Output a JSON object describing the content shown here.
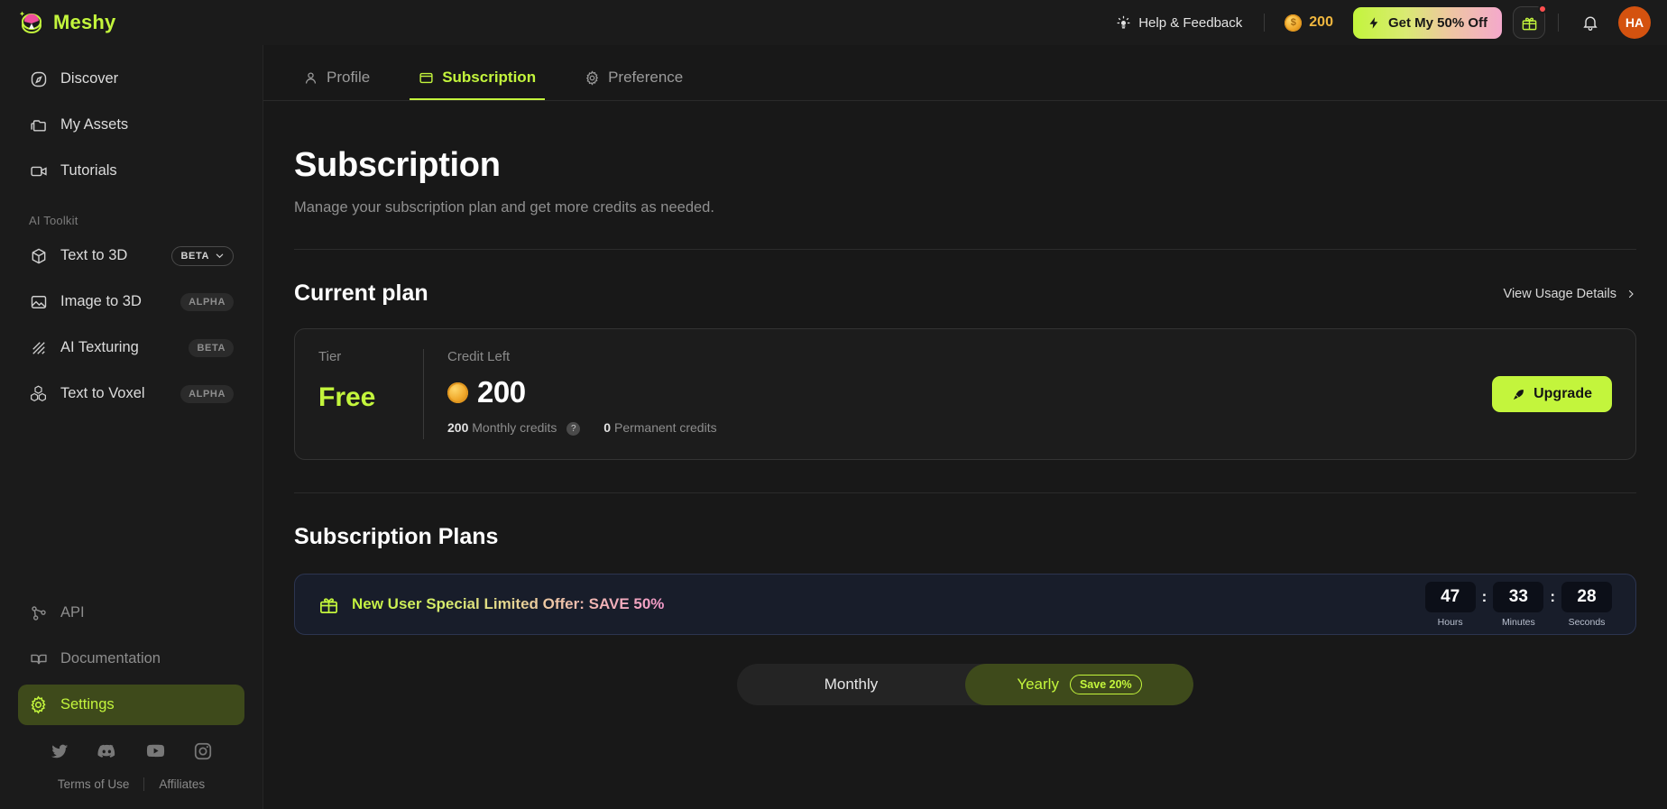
{
  "brand": {
    "name": "Meshy",
    "logo_icon": "meshy-logo-icon"
  },
  "topbar": {
    "help_label": "Help & Feedback",
    "help_icon": "lightbulb-icon",
    "credits_value": "200",
    "coin_icon": "coin-icon",
    "promo_label": "Get My 50% Off",
    "promo_icon": "bolt-icon",
    "gift_icon": "gift-icon",
    "bell_icon": "bell-icon",
    "avatar_initials": "HA"
  },
  "sidebar": {
    "items": [
      {
        "label": "Discover",
        "icon": "compass-icon"
      },
      {
        "label": "My Assets",
        "icon": "folder-icon"
      },
      {
        "label": "Tutorials",
        "icon": "video-icon"
      }
    ],
    "group_label": "AI Toolkit",
    "toolkit": [
      {
        "label": "Text to 3D",
        "icon": "cube-icon",
        "tag": "BETA",
        "tag_style": "outlined",
        "tag_chevron": "chevron-down-icon"
      },
      {
        "label": "Image to 3D",
        "icon": "image-icon",
        "tag": "ALPHA",
        "tag_style": "filled"
      },
      {
        "label": "AI Texturing",
        "icon": "texture-icon",
        "tag": "BETA",
        "tag_style": "filled"
      },
      {
        "label": "Text to Voxel",
        "icon": "voxel-icon",
        "tag": "ALPHA",
        "tag_style": "filled"
      }
    ],
    "bottom": [
      {
        "label": "API",
        "icon": "api-icon",
        "active": false
      },
      {
        "label": "Documentation",
        "icon": "book-icon",
        "active": false
      },
      {
        "label": "Settings",
        "icon": "gear-icon",
        "active": true
      }
    ],
    "socials": [
      {
        "name": "twitter-icon"
      },
      {
        "name": "discord-icon"
      },
      {
        "name": "youtube-icon"
      },
      {
        "name": "instagram-icon"
      }
    ],
    "footer": {
      "terms": "Terms of Use",
      "affiliates": "Affiliates"
    }
  },
  "tabs": [
    {
      "label": "Profile",
      "icon": "user-icon",
      "active": false
    },
    {
      "label": "Subscription",
      "icon": "card-icon",
      "active": true
    },
    {
      "label": "Preference",
      "icon": "gear-icon",
      "active": false
    }
  ],
  "page": {
    "title": "Subscription",
    "subtitle": "Manage your subscription plan and get more credits as needed."
  },
  "current_plan": {
    "heading": "Current plan",
    "view_usage_label": "View Usage Details",
    "view_usage_icon": "chevron-right-icon",
    "tier_label": "Tier",
    "tier_value": "Free",
    "credit_label": "Credit Left",
    "credit_value": "200",
    "coin_icon": "coin-icon",
    "monthly_credits_value": "200",
    "monthly_credits_label": "Monthly credits",
    "monthly_help_icon": "question-icon",
    "permanent_credits_value": "0",
    "permanent_credits_label": "Permanent credits",
    "upgrade_label": "Upgrade",
    "upgrade_icon": "rocket-icon"
  },
  "plans": {
    "heading": "Subscription Plans",
    "offer": {
      "icon": "gift-icon",
      "text": "New User Special Limited Offer: SAVE 50%",
      "timer": [
        {
          "value": "47",
          "label": "Hours"
        },
        {
          "value": "33",
          "label": "Minutes"
        },
        {
          "value": "28",
          "label": "Seconds"
        }
      ],
      "separator": ":"
    },
    "billing": {
      "monthly_label": "Monthly",
      "yearly_label": "Yearly",
      "yearly_badge": "Save 20%",
      "selected": "Yearly"
    }
  },
  "colors": {
    "accent": "#c3f53c",
    "coin": "#f0b73f",
    "avatar": "#d4520f",
    "banner_bg": "#181d2a",
    "active_nav_bg": "#3e4a1b"
  }
}
